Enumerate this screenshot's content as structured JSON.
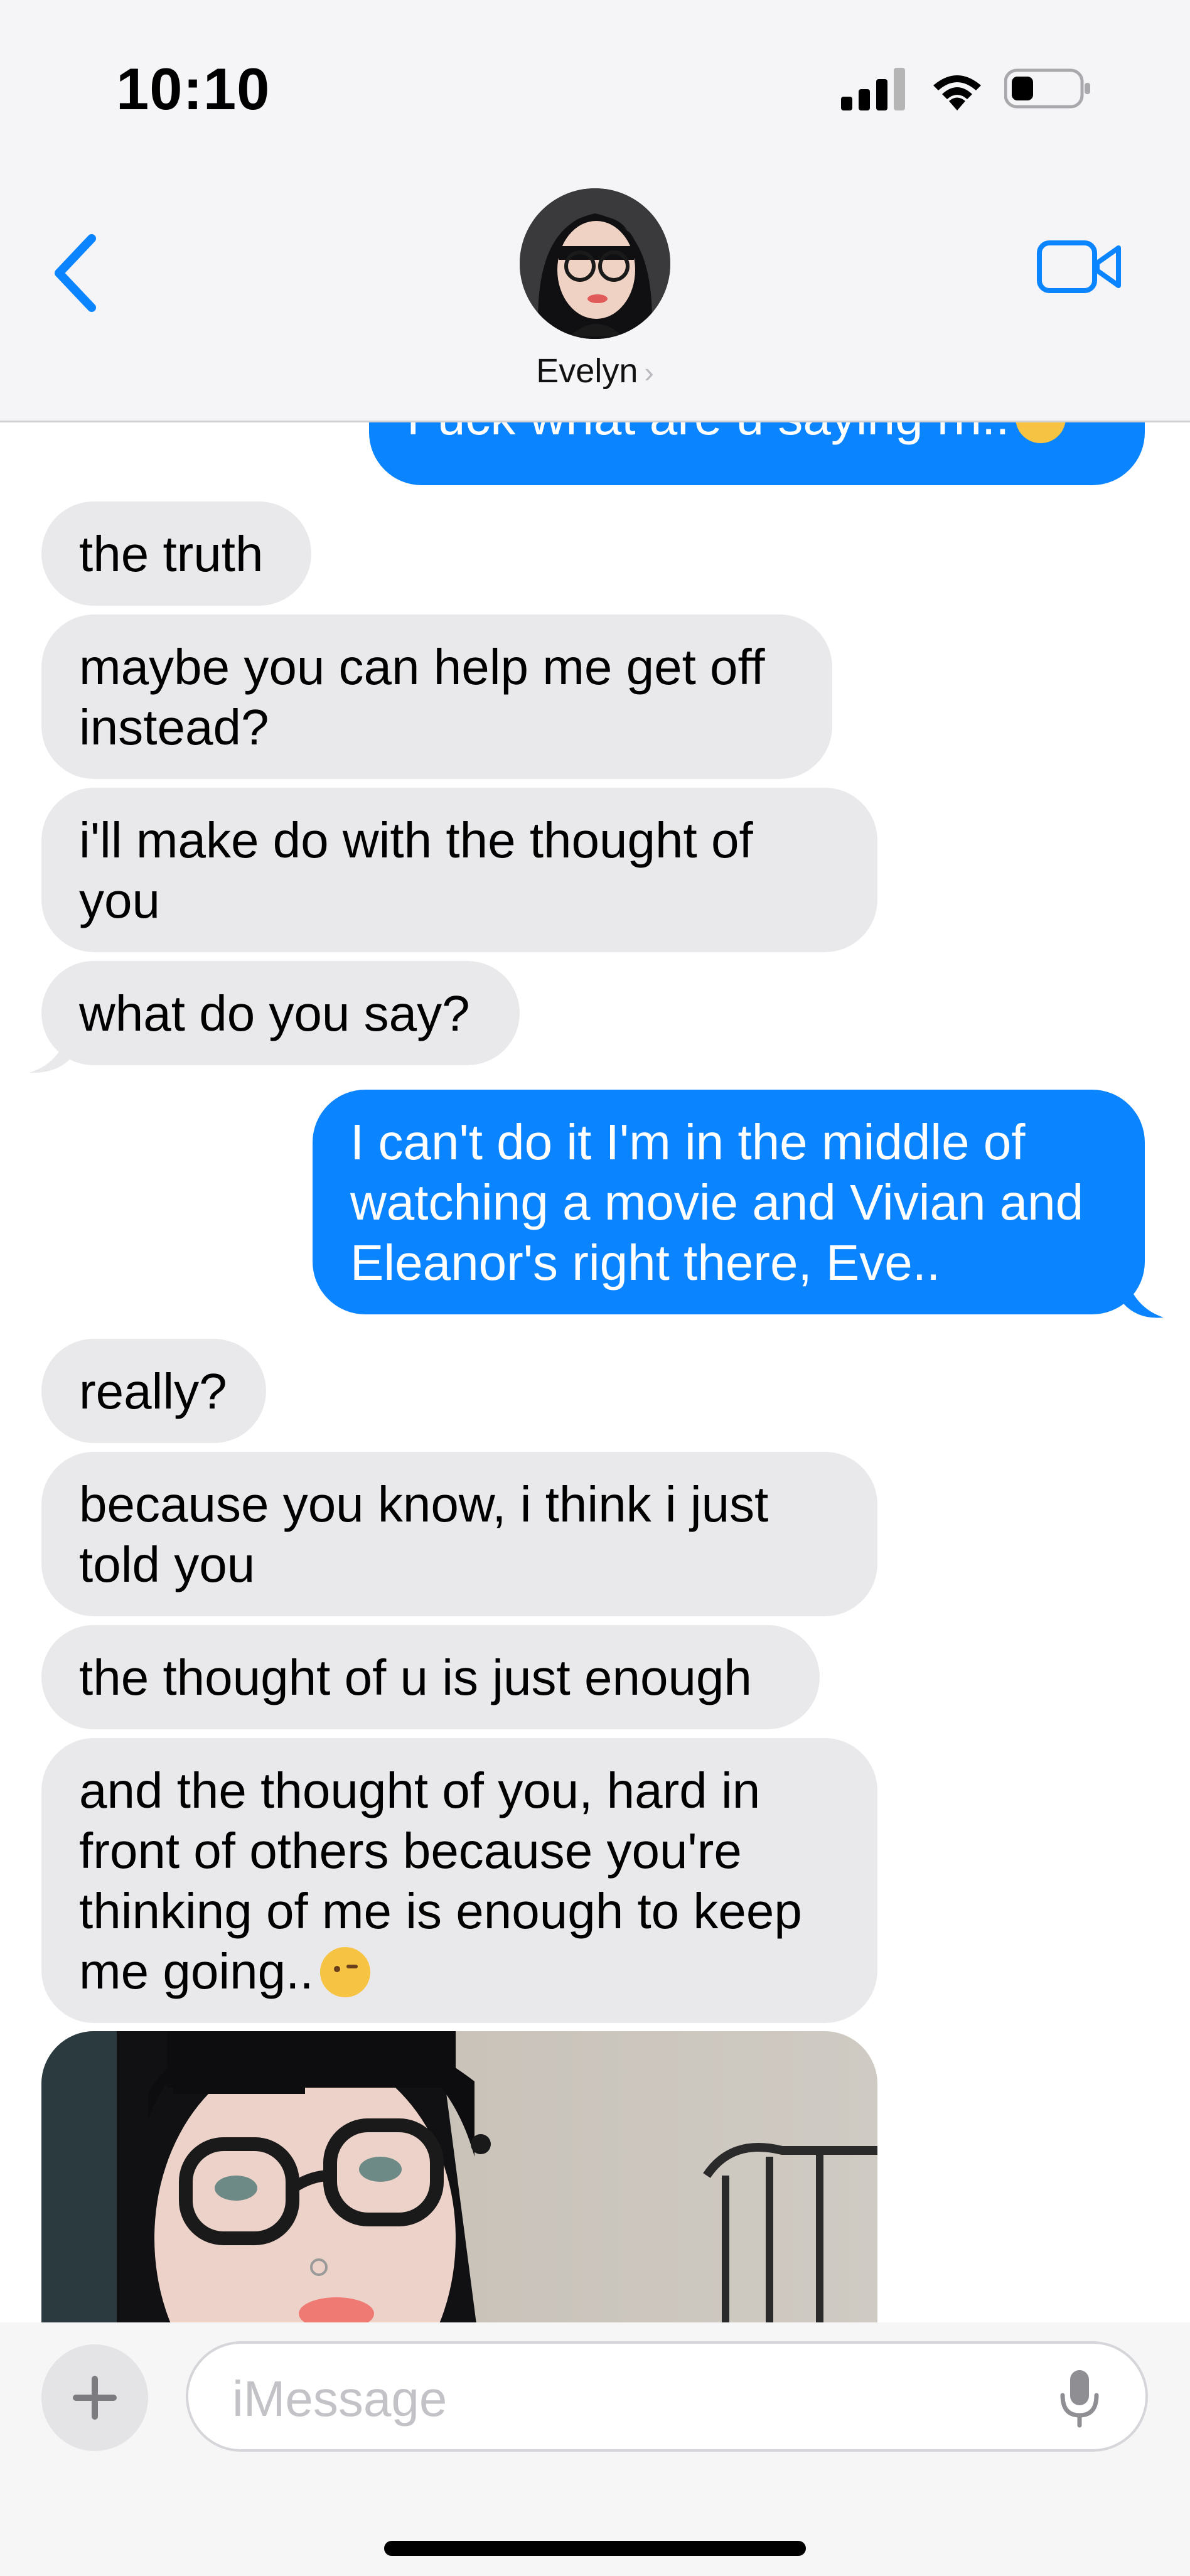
{
  "status": {
    "time": "10:10"
  },
  "header": {
    "contact_name": "Evelyn",
    "chevron": "›",
    "avatar": "contact-photo"
  },
  "messages": {
    "m0": "Fuck what are u saying rn..",
    "m1": "the truth",
    "m2": "maybe you can help me get off instead?",
    "m3": "i'll make do with the thought of you",
    "m4": "what do you say?",
    "m5": "I can't do it I'm in the middle of watching a movie and Vivian and Eleanor's right there, Eve..",
    "m6": "really?",
    "m7": "because you know, i think i just told you",
    "m8": "the thought of u is just enough",
    "m9": "and the thought of you, hard in front of others because you're thinking of me is enough to keep me going..",
    "photo": "photo-attachment"
  },
  "composer": {
    "placeholder": "iMessage",
    "plus": "+"
  },
  "colors": {
    "outgoing": "#0a84ff",
    "incoming": "#e9e9eb",
    "accent": "#0a84ff"
  },
  "icons": [
    "back-chevron-icon",
    "video-camera-icon",
    "signal-icon",
    "wifi-icon",
    "battery-icon",
    "mic-icon",
    "plus-icon"
  ]
}
